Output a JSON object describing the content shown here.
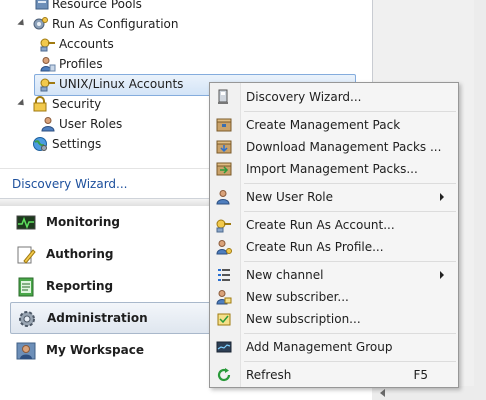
{
  "tree": {
    "resource_pools": "Resource Pools",
    "run_as_configuration": "Run As Configuration",
    "accounts": "Accounts",
    "profiles": "Profiles",
    "unix_linux_accounts": "UNIX/Linux Accounts",
    "security": "Security",
    "user_roles": "User Roles",
    "settings": "Settings"
  },
  "tasks": {
    "discovery_wizard_link": "Discovery Wizard..."
  },
  "wunderbar": {
    "monitoring": "Monitoring",
    "authoring": "Authoring",
    "reporting": "Reporting",
    "administration": "Administration",
    "my_workspace": "My Workspace"
  },
  "context_menu": {
    "discovery_wizard": "Discovery Wizard...",
    "create_management_pack": "Create Management Pack",
    "download_management_packs": "Download Management Packs ...",
    "import_management_packs": "Import Management Packs...",
    "new_user_role": "New User Role",
    "create_run_as_account": "Create Run As Account...",
    "create_run_as_profile": "Create Run As Profile...",
    "new_channel": "New channel",
    "new_subscriber": "New subscriber...",
    "new_subscription": "New subscription...",
    "add_management_group": "Add Management Group",
    "refresh": "Refresh",
    "refresh_shortcut": "F5"
  },
  "colors": {
    "link": "#1c4f9c",
    "selection_border": "#84acdd",
    "menu_background": "#f5f5f5"
  }
}
